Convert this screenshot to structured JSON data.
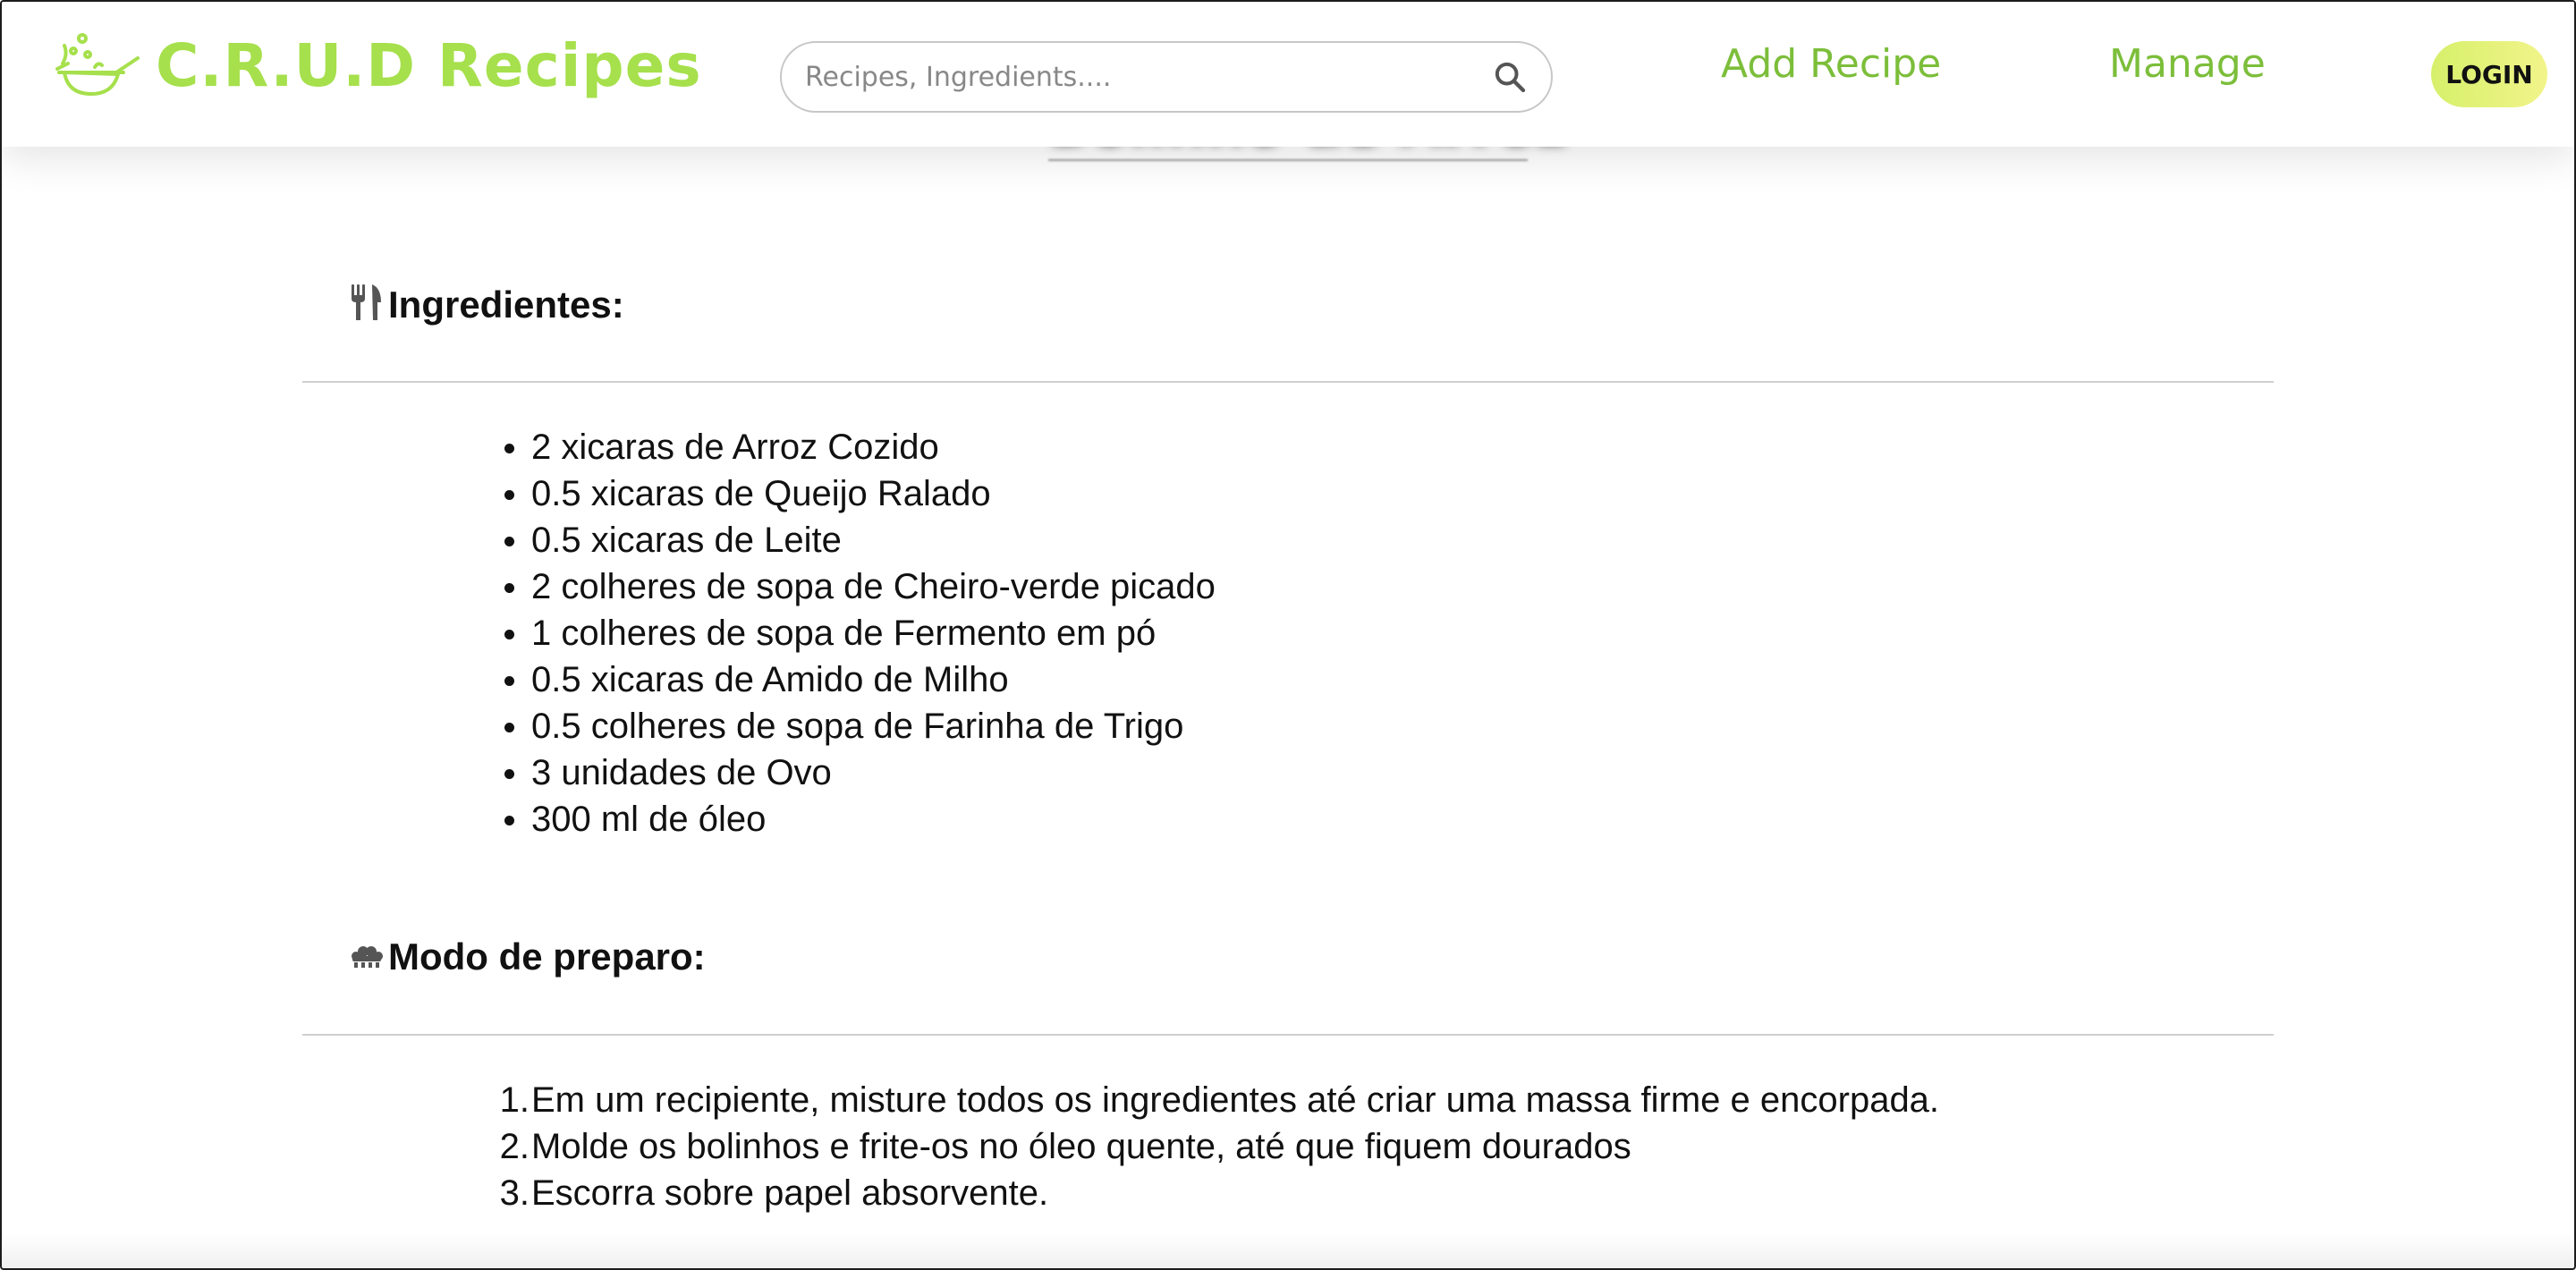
{
  "header": {
    "logo_text": "C.R.U.D Recipes",
    "logo_icon": "wok-icon",
    "search_placeholder": "Recipes, Ingredients....",
    "search_value": "",
    "nav_add_recipe": "Add Recipe",
    "nav_manage": "Manage",
    "login_label": "LOGIN"
  },
  "recipe": {
    "title": "Bolinho de Arroz",
    "ingredients_heading": "Ingredientes:",
    "ingredients_icon": "utensils-icon",
    "ingredients": [
      "2 xicaras de Arroz Cozido",
      "0.5 xicaras de Queijo Ralado",
      "0.5 xicaras de Leite",
      "2 colheres de sopa de Cheiro-verde picado",
      "1 colheres de sopa de Fermento em pó",
      "0.5 xicaras de Amido de Milho",
      "0.5 colheres de sopa de Farinha de Trigo",
      "3 unidades de Ovo",
      "300 ml de óleo"
    ],
    "steps_heading": "Modo de preparo:",
    "steps_icon": "chef-hat-icon",
    "steps": [
      "Em um recipiente, misture todos os ingredientes até criar uma massa firme e encorpada.",
      "Molde os bolinhos e frite-os no óleo quente, até que fiquem dourados",
      "Escorra sobre papel absorvente."
    ],
    "step_numbers": [
      "1.",
      "2.",
      "3."
    ]
  },
  "colors": {
    "brand_green": "#a6e04c",
    "nav_green": "#7cbe3a",
    "login_gradient_start": "#d6f06b",
    "login_gradient_end": "#f2f48a"
  }
}
